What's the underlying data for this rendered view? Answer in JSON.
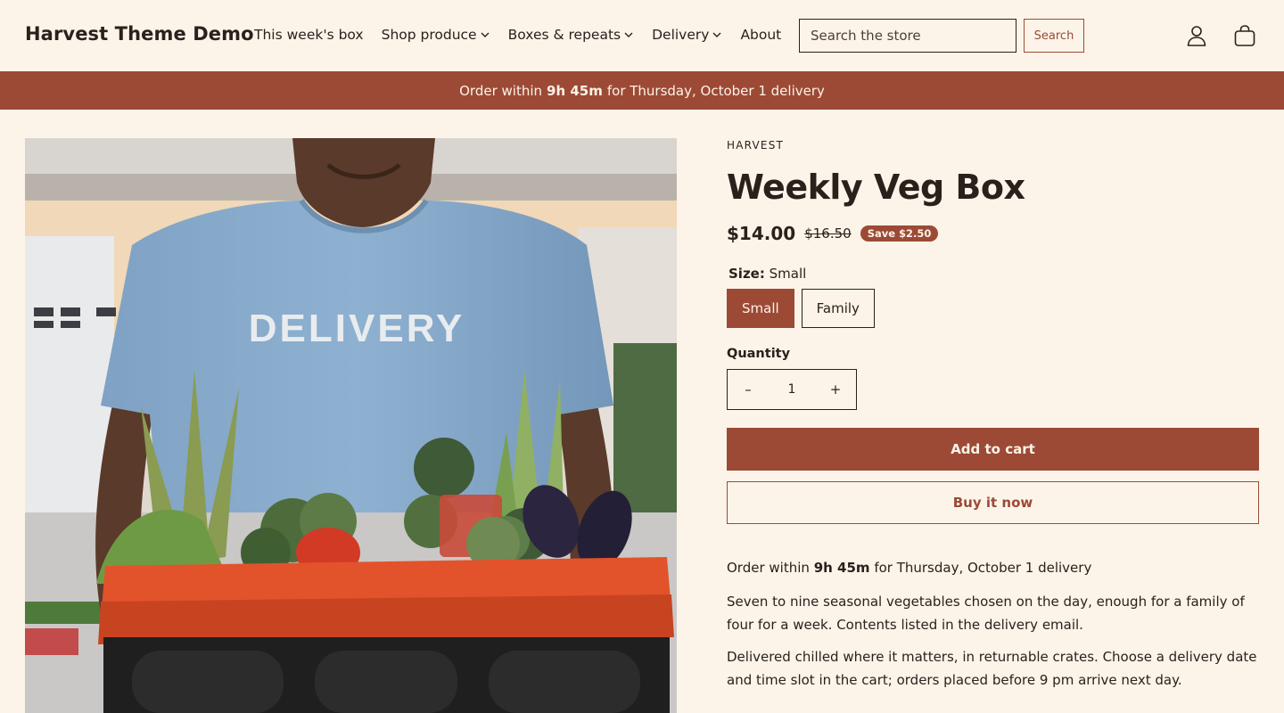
{
  "header": {
    "logo": "Harvest Theme Demo",
    "nav": [
      {
        "label": "This week's box",
        "has_dropdown": false
      },
      {
        "label": "Shop produce",
        "has_dropdown": true
      },
      {
        "label": "Boxes & repeats",
        "has_dropdown": true
      },
      {
        "label": "Delivery",
        "has_dropdown": true
      },
      {
        "label": "About",
        "has_dropdown": false
      }
    ],
    "search_placeholder": "Search the store",
    "search_button": "Search",
    "account_icon": "user-icon",
    "cart_icon": "bag-icon"
  },
  "announcement": {
    "prefix": "Order within",
    "time": "9h 45m",
    "suffix": "for Thursday, October 1 delivery"
  },
  "product": {
    "vendor": "HARVEST",
    "title": "Weekly Veg Box",
    "price": "$14.00",
    "compare_price": "$16.50",
    "badge": "Save $2.50",
    "size_label": "Size:",
    "size_value": "Small",
    "size_options": [
      "Small",
      "Family"
    ],
    "selected_size": "Small",
    "quantity_label": "Quantity",
    "quantity": "1",
    "qty_minus": "–",
    "qty_plus": "+",
    "add_to_cart": "Add to cart",
    "buy_now": "Buy it now",
    "cutoff_prefix": "Order within",
    "cutoff_time": "9h 45m",
    "cutoff_suffix": "for Thursday, October 1 delivery",
    "description": [
      "Seven to nine seasonal vegetables chosen on the day, enough for a family of four for a week. Contents listed in the delivery email.",
      "Delivered chilled where it matters, in returnable crates. Choose a delivery date and time slot in the cart; orders placed before 9 pm arrive next day."
    ],
    "image_shirt_text": "DELIVERY"
  },
  "colors": {
    "accent": "#9c4a36",
    "background": "#fcf4e9",
    "text": "#2a211c"
  }
}
